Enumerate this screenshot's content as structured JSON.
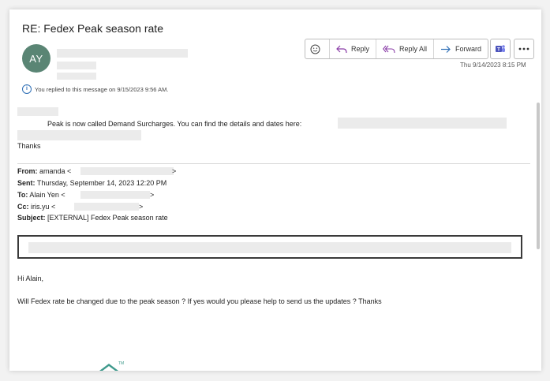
{
  "email": {
    "subject": "RE: Fedex Peak season rate",
    "sender_initials": "AY",
    "date": "Thu 9/14/2023 8:15 PM",
    "replied_notice": "You replied to this message on 9/15/2023 9:56 AM."
  },
  "toolbar": {
    "reply_label": "Reply",
    "reply_all_label": "Reply All",
    "forward_label": "Forward"
  },
  "body": {
    "line1": "Peak is now called Demand Surcharges. You can find the details and dates here:",
    "thanks": "Thanks"
  },
  "quoted_header": {
    "from_label": "From:",
    "from_value": " amanda <",
    "from_close": ">",
    "sent_label": "Sent:",
    "sent_value": " Thursday, September 14, 2023 12:20 PM",
    "to_label": "To:",
    "to_value": " Alain Yen <",
    "to_close": ">",
    "cc_label": "Cc:",
    "cc_value": " iris.yu <",
    "cc_close": ">",
    "subject_label": "Subject:",
    "subject_value": " [EXTERNAL] Fedex Peak season rate"
  },
  "quoted_body": {
    "greeting": "Hi Alain,",
    "message": "Will Fedex rate be changed due to the peak season ? If yes would you please help to send us the updates ? Thanks"
  },
  "logo": {
    "tm": "TM"
  },
  "colors": {
    "avatar": "#5a8574",
    "reply_icon": "#8b3fa8",
    "forward_icon": "#2f6fb6",
    "teams": "#4b53bc"
  }
}
